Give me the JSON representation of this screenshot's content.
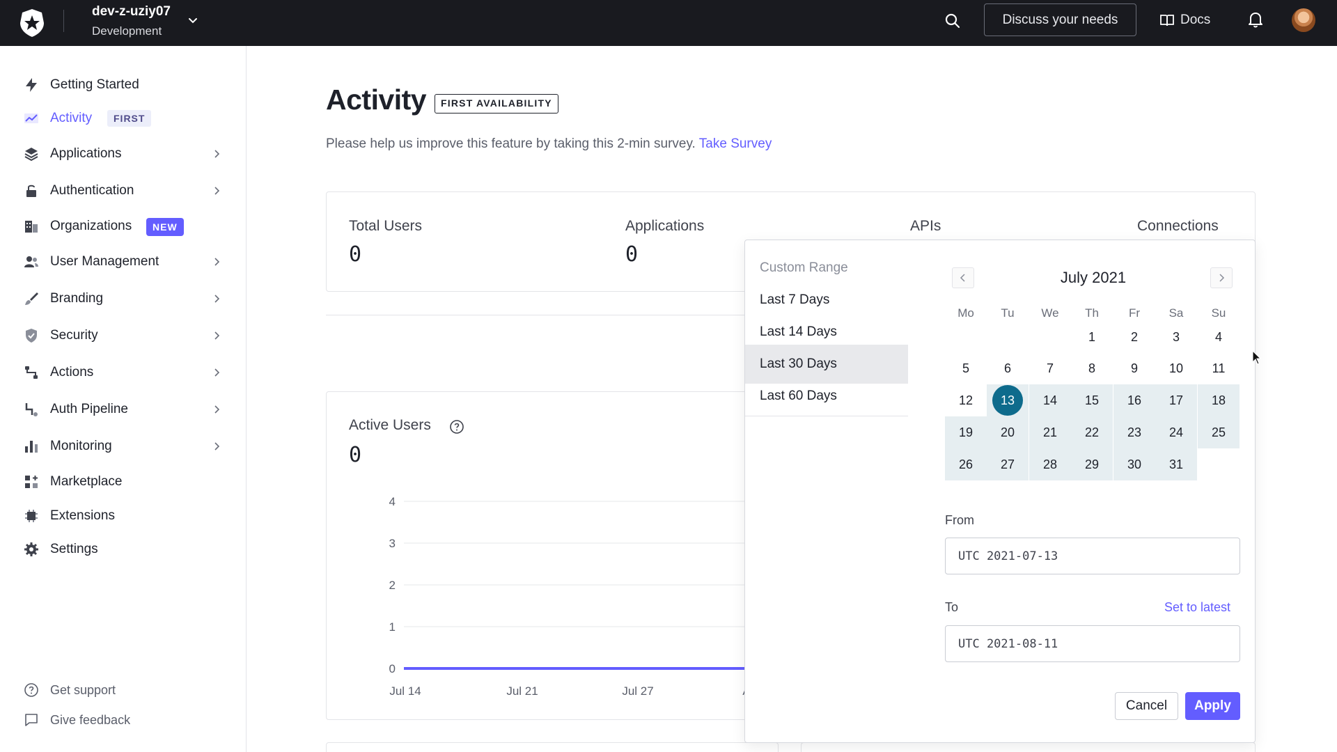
{
  "topbar": {
    "tenant_name": "dev-z-uziy07",
    "tenant_env": "Development",
    "discuss_label": "Discuss your needs",
    "docs_label": "Docs"
  },
  "sidebar": {
    "items": [
      {
        "label": "Getting Started",
        "icon": "bolt-icon"
      },
      {
        "label": "Activity",
        "icon": "trend-icon",
        "badge": "FIRST"
      },
      {
        "label": "Applications",
        "icon": "layers-icon"
      },
      {
        "label": "Authentication",
        "icon": "lock-icon"
      },
      {
        "label": "Organizations",
        "icon": "building-icon",
        "badge": "NEW"
      },
      {
        "label": "User Management",
        "icon": "users-icon"
      },
      {
        "label": "Branding",
        "icon": "brush-icon"
      },
      {
        "label": "Security",
        "icon": "shield-icon"
      },
      {
        "label": "Actions",
        "icon": "flow-icon"
      },
      {
        "label": "Auth Pipeline",
        "icon": "pipeline-icon"
      },
      {
        "label": "Monitoring",
        "icon": "bar-chart-icon"
      },
      {
        "label": "Marketplace",
        "icon": "grid-plus-icon"
      },
      {
        "label": "Extensions",
        "icon": "chip-icon"
      },
      {
        "label": "Settings",
        "icon": "gear-icon"
      }
    ],
    "footer": {
      "support": "Get support",
      "feedback": "Give feedback"
    }
  },
  "main": {
    "title": "Activity",
    "title_badge": "FIRST AVAILABILITY",
    "survey_text": "Please help us improve this feature by taking this 2-min survey.",
    "survey_link": "Take Survey",
    "stats": [
      {
        "label": "Total Users",
        "value": "0"
      },
      {
        "label": "Applications",
        "value": "0"
      },
      {
        "label": "APIs",
        "value": ""
      },
      {
        "label": "Connections",
        "value": ""
      }
    ],
    "active_users": {
      "title": "Active Users",
      "value": "0"
    }
  },
  "chart_data": {
    "type": "line",
    "title": "Active Users",
    "xlabel": "",
    "ylabel": "",
    "x": [
      "Jul 14",
      "Jul 21",
      "Jul 27",
      "A"
    ],
    "y_ticks": [
      0,
      1,
      2,
      3,
      4
    ],
    "ylim": [
      0,
      4
    ],
    "series": [
      {
        "values": [
          0,
          0,
          0,
          0
        ],
        "color": "#635dff"
      }
    ]
  },
  "picker": {
    "presets": [
      {
        "label": "Custom Range",
        "muted": true,
        "selected": false
      },
      {
        "label": "Last 7 Days",
        "muted": false,
        "selected": false
      },
      {
        "label": "Last 14 Days",
        "muted": false,
        "selected": false
      },
      {
        "label": "Last 30 Days",
        "muted": false,
        "selected": true
      },
      {
        "label": "Last 60 Days",
        "muted": false,
        "selected": false
      }
    ],
    "month_label": "July 2021",
    "weekdays": [
      "Mo",
      "Tu",
      "We",
      "Th",
      "Fr",
      "Sa",
      "Su"
    ],
    "first_weekday_index": 3,
    "days_in_month": 31,
    "selected_day": 13,
    "range_start": 13,
    "from_label": "From",
    "from_value": "UTC  2021-07-13",
    "to_label": "To",
    "to_value": "UTC  2021-08-11",
    "set_latest": "Set to latest",
    "cancel": "Cancel",
    "apply": "Apply"
  },
  "colors": {
    "accent": "#635dff",
    "selected_day": "#0e6b8c",
    "range_bg": "#e6eef1",
    "topbar_bg": "#191a1f"
  }
}
